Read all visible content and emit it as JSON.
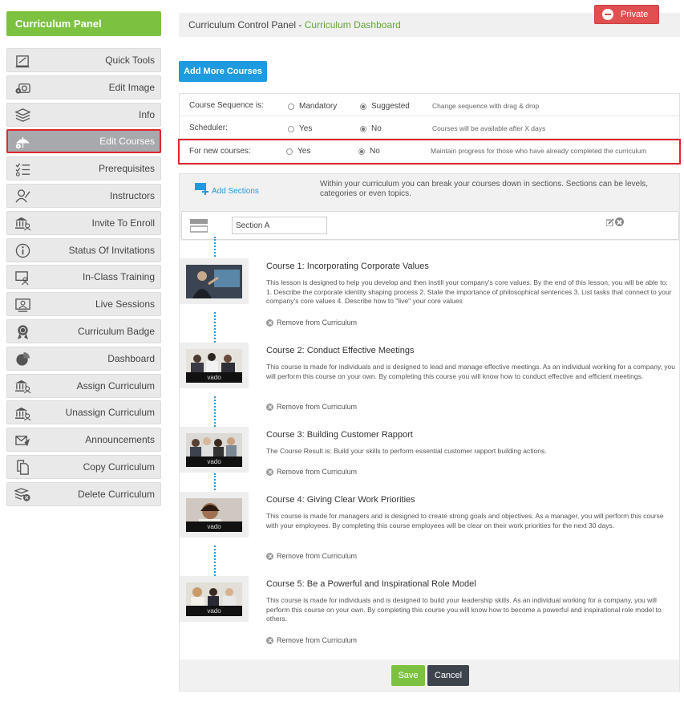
{
  "sidebar": {
    "title": "Curriculum Panel",
    "items": [
      {
        "label": "Quick Tools",
        "icon": "quick-tools-icon"
      },
      {
        "label": "Edit Image",
        "icon": "camera-gear-icon"
      },
      {
        "label": "Info",
        "icon": "info-stack-icon"
      },
      {
        "label": "Edit Courses",
        "icon": "umbrella-gear-icon",
        "active": true
      },
      {
        "label": "Prerequisites",
        "icon": "checklist-icon"
      },
      {
        "label": "Instructors",
        "icon": "instructor-icon"
      },
      {
        "label": "Invite To Enroll",
        "icon": "institution-user-icon"
      },
      {
        "label": "Status Of Invitations",
        "icon": "info-circle-icon"
      },
      {
        "label": "In-Class Training",
        "icon": "classroom-icon"
      },
      {
        "label": "Live Sessions",
        "icon": "live-session-icon"
      },
      {
        "label": "Curriculum Badge",
        "icon": "badge-icon"
      },
      {
        "label": "Dashboard",
        "icon": "pie-chart-icon"
      },
      {
        "label": "Assign Curriculum",
        "icon": "institution-user-icon"
      },
      {
        "label": "Unassign Curriculum",
        "icon": "institution-user-icon"
      },
      {
        "label": "Announcements",
        "icon": "send-mail-icon"
      },
      {
        "label": "Copy Curriculum",
        "icon": "copy-icon"
      },
      {
        "label": "Delete Curriculum",
        "icon": "delete-stack-icon"
      }
    ]
  },
  "header": {
    "breadcrumb_root": "Curriculum Control Panel",
    "breadcrumb_sep": " - ",
    "breadcrumb_current": "Curriculum Dashboard",
    "private_label": "Private"
  },
  "actions": {
    "add_more_courses": "Add More Courses"
  },
  "settings": [
    {
      "label": "Course Sequence is:",
      "opt1": "Mandatory",
      "opt2": "Suggested",
      "selected": 2,
      "note": "Change sequence with drag & drop"
    },
    {
      "label": "Scheduler:",
      "opt1": "Yes",
      "opt2": "No",
      "selected": 2,
      "note": "Courses will be available after X days"
    },
    {
      "label": "For new courses:",
      "opt1": "Yes",
      "opt2": "No",
      "selected": 2,
      "note": "Maintain progress for those who have already completed the curriculum"
    }
  ],
  "sections": {
    "add_label": "Add Sections",
    "note": "Within your curriculum you can break your courses down in sections. Sections can be levels, categories or even topics.",
    "section_name": "Section A"
  },
  "courses": [
    {
      "prefix": "Course 1:",
      "title": "Incorporating Corporate Values",
      "description": "This lesson is designed to help you develop and then instill your company's core values. By the end of this lesson, you will be able to:  1. Describe the corporate identity shaping process 2. State the importance of philosophical sentences 3. List tasks that connect to your company's core values 4. Describe how to \"live\" your core values",
      "remove": "Remove from Curriculum",
      "thumb_text": ""
    },
    {
      "prefix": "Course 2:",
      "title": "Conduct Effective Meetings",
      "description": "This course is made for individuals and is designed to lead and manage effective meetings. As an individual working for a company, you will perform this course on your own. By completing this course you will know how to conduct effective and efficient meetings.",
      "remove": "Remove from Curriculum",
      "thumb_text": "vado"
    },
    {
      "prefix": "Course 3:",
      "title": "Building Customer Rapport",
      "description": "The Course Result is: Build your skills to perform essential customer rapport building actions.",
      "remove": "Remove from Curriculum",
      "thumb_text": "vado"
    },
    {
      "prefix": "Course 4:",
      "title": "Giving Clear Work Priorities",
      "description": "This course is made for managers and is designed to create strong goals and objectives. As a manager, you will perform this course with your employees. By completing this course employees will be clear on their work priorities for the next 30 days.",
      "remove": "Remove from Curriculum",
      "thumb_text": "vado"
    },
    {
      "prefix": "Course 5:",
      "title": "Be a Powerful and Inspirational Role Model",
      "description": "This course is made for individuals and is designed to build your leadership skills. As an individual working for a company, you will perform this course on your own. By completing this course you will know how to become a powerful and inspirational role model to others.",
      "remove": "Remove from Curriculum",
      "thumb_text": "vado"
    }
  ],
  "footer": {
    "save": "Save",
    "cancel": "Cancel"
  },
  "colors": {
    "brand_green": "#7cc240",
    "accent_blue": "#1e9be0",
    "danger_red": "#e05050",
    "highlight_red": "#e0262e"
  }
}
